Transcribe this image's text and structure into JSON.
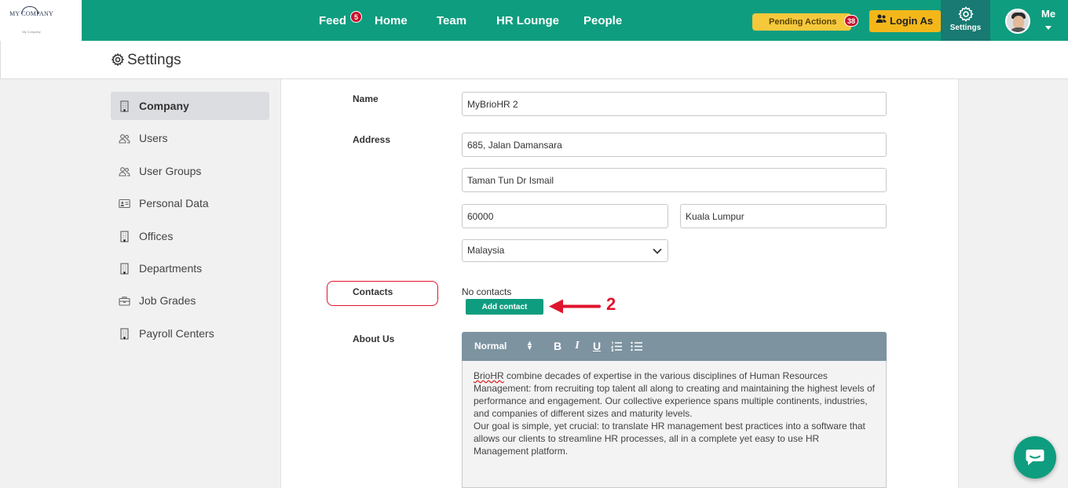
{
  "logo": {
    "name": "MY COMPANY",
    "tagline": "My Company"
  },
  "nav": {
    "feed": "Feed",
    "feed_badge": "5",
    "home": "Home",
    "team": "Team",
    "hr_lounge": "HR Lounge",
    "people": "People"
  },
  "pending": {
    "label": "Pending Actions",
    "count": "38"
  },
  "login_as": "Login As",
  "settings_label": "Settings",
  "user_label": "Me",
  "page_title": "Settings",
  "sidebar": {
    "items": [
      {
        "label": "Company",
        "icon": "building-icon"
      },
      {
        "label": "Users",
        "icon": "users-icon"
      },
      {
        "label": "User Groups",
        "icon": "users-icon"
      },
      {
        "label": "Personal Data",
        "icon": "id-card-icon"
      },
      {
        "label": "Offices",
        "icon": "building-icon"
      },
      {
        "label": "Departments",
        "icon": "building-icon"
      },
      {
        "label": "Job Grades",
        "icon": "briefcase-icon"
      },
      {
        "label": "Payroll Centers",
        "icon": "building-icon"
      }
    ]
  },
  "form": {
    "name_label": "Name",
    "name_value": "MyBrioHR 2",
    "address_label": "Address",
    "address_line1": "685, Jalan Damansara",
    "address_line2": "Taman Tun Dr Ismail",
    "postcode": "60000",
    "city": "Kuala Lumpur",
    "country": "Malaysia",
    "contacts_label": "Contacts",
    "no_contacts": "No contacts",
    "add_contact": "Add contact",
    "step_number": "2",
    "about_label": "About Us",
    "editor_format": "Normal",
    "about_word": "BrioHR",
    "about_p1_rest": " combine decades of expertise in the various disciplines of Human Resources Management: from recruiting top talent all along to creating and maintaining the highest levels of performance and engagement. Our collective experience spans multiple continents, industries, and companies of different sizes and maturity levels.",
    "about_p2": "Our goal is simple, yet crucial: to translate HR management best practices into a software that allows our clients to streamline HR processes, all in a complete yet easy to use HR Management platform."
  },
  "colors": {
    "brand": "#0f9d7f",
    "accent": "#f4b71a",
    "highlight": "#e0142d"
  }
}
